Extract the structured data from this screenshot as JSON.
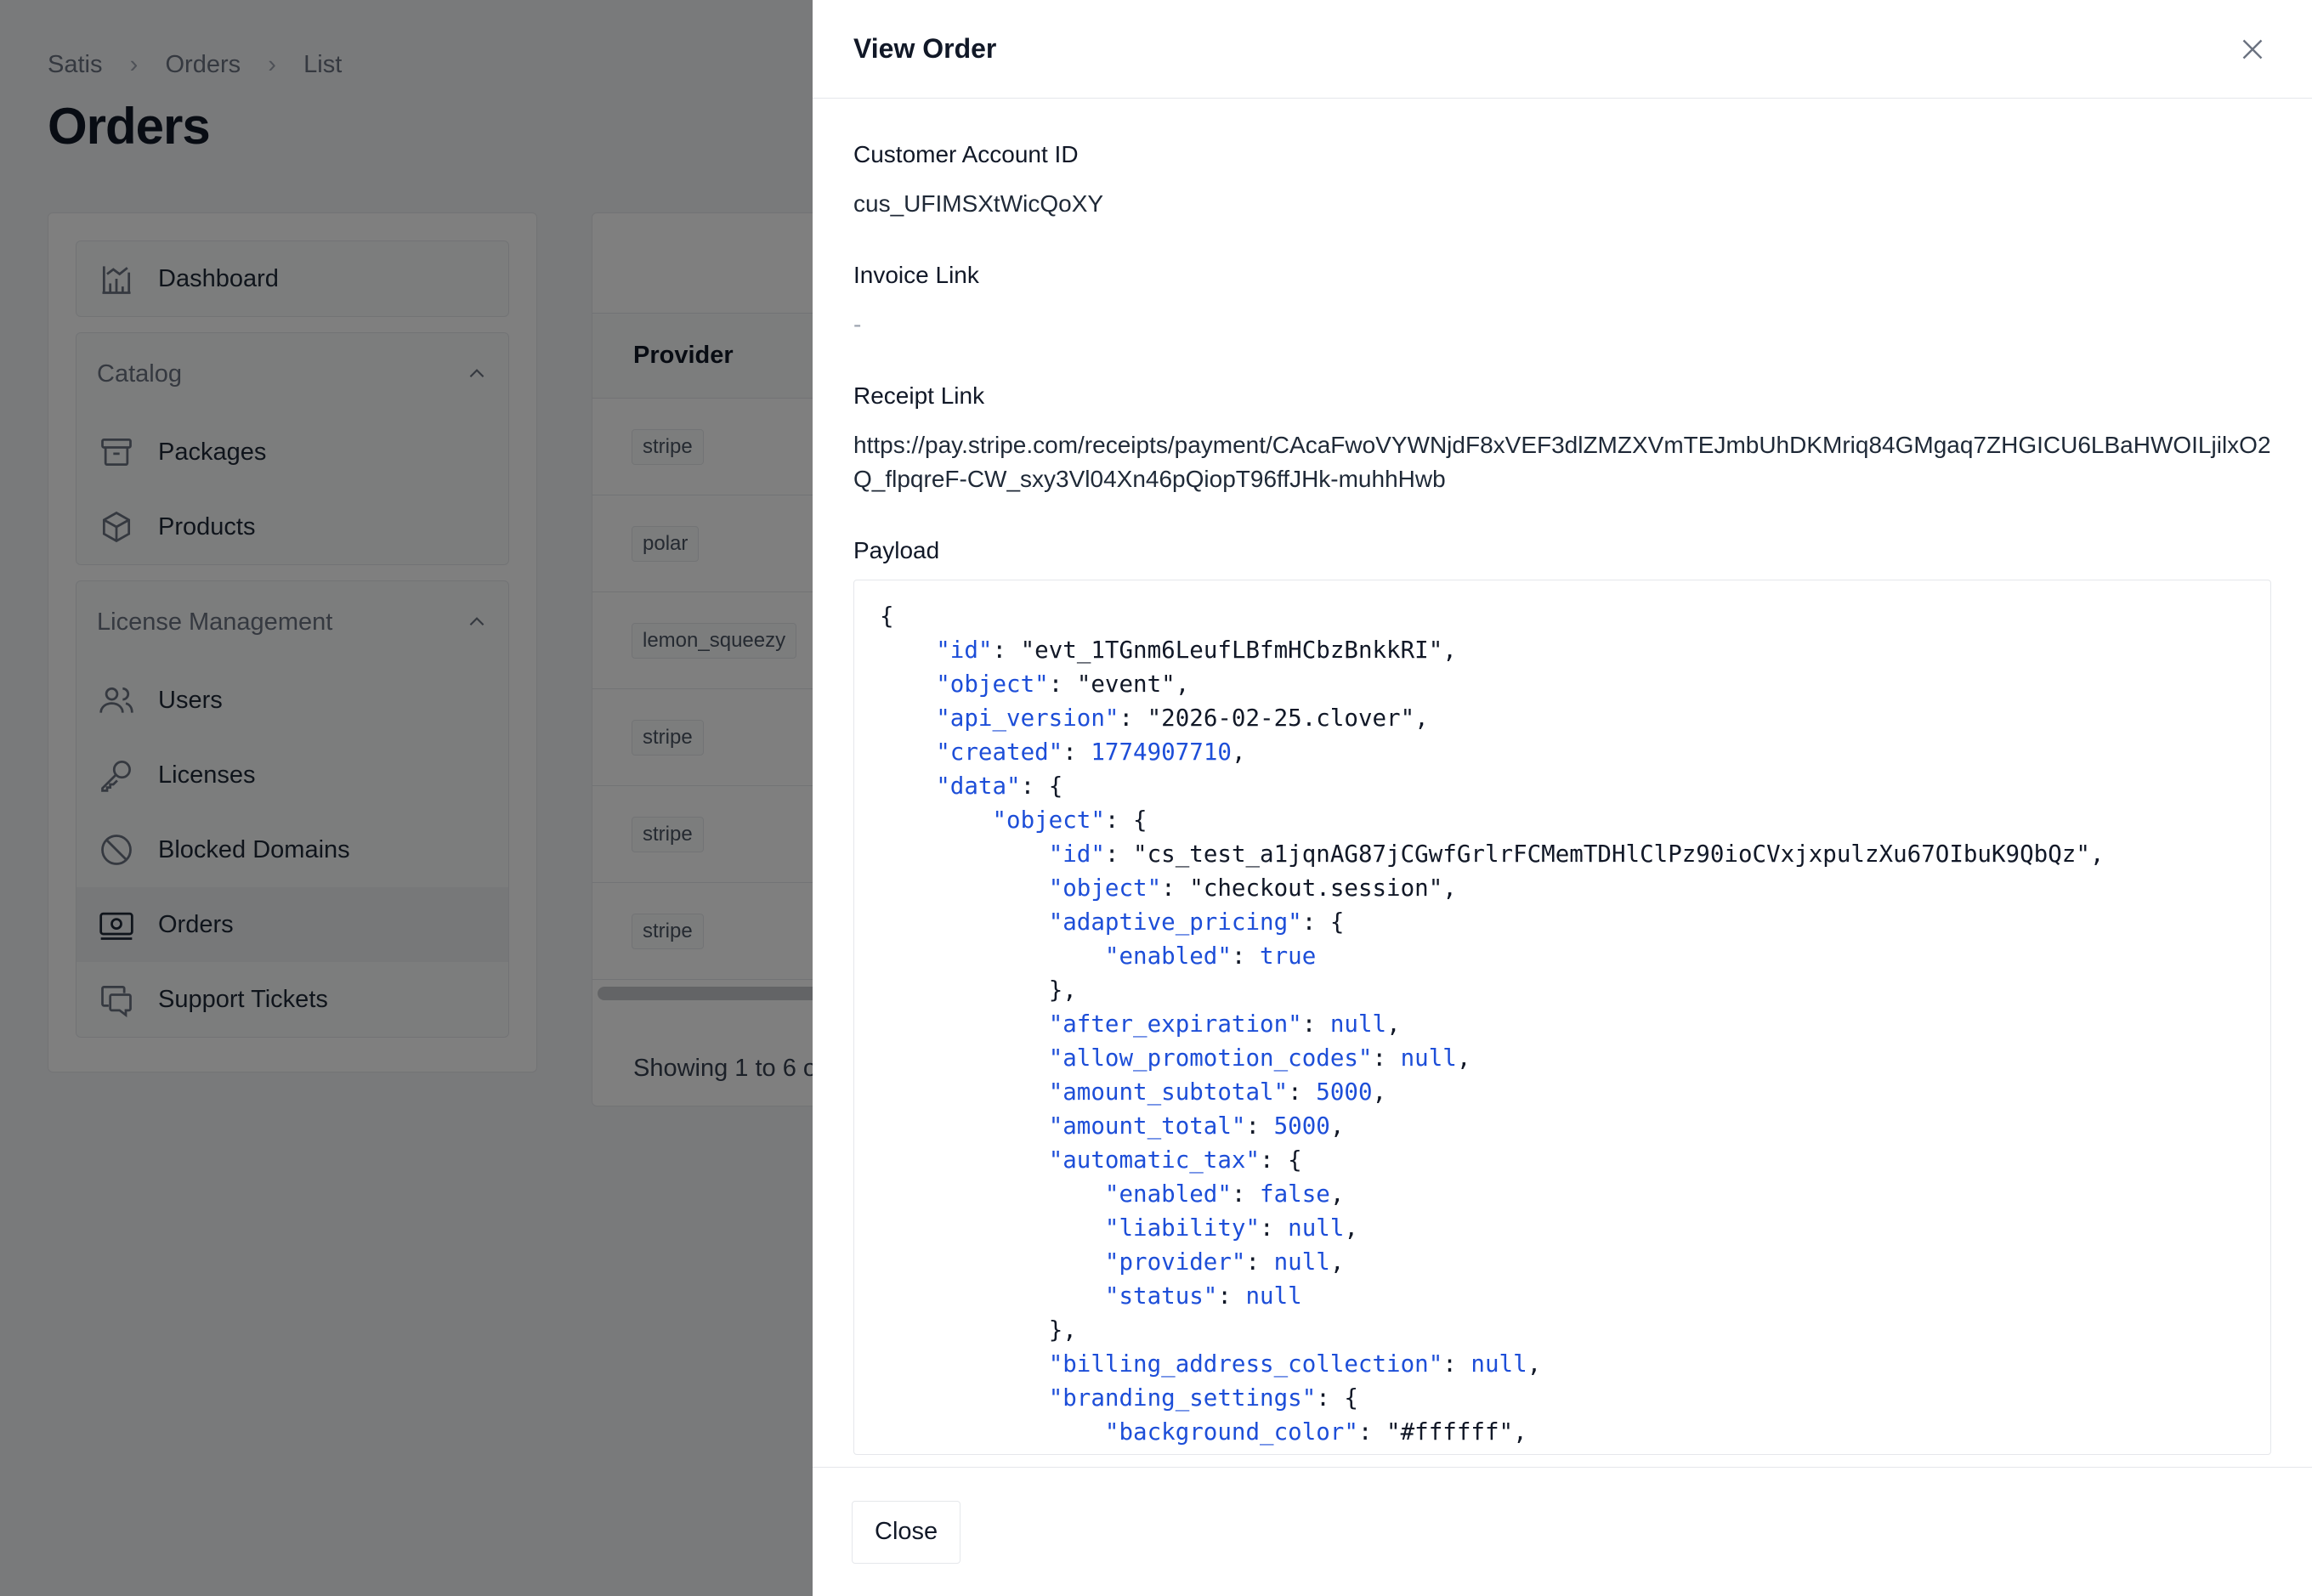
{
  "breadcrumb": [
    "Satis",
    "Orders",
    "List"
  ],
  "page_title": "Orders",
  "sidebar": {
    "dashboard": "Dashboard",
    "catalog": {
      "title": "Catalog",
      "items": [
        "Packages",
        "Products"
      ]
    },
    "license_management": {
      "title": "License Management",
      "items": [
        "Users",
        "Licenses",
        "Blocked Domains",
        "Orders",
        "Support Tickets"
      ]
    }
  },
  "table": {
    "column_provider": "Provider",
    "rows": [
      "stripe",
      "polar",
      "lemon_squeezy",
      "stripe",
      "stripe",
      "stripe"
    ],
    "footer": "Showing 1 to 6 o"
  },
  "modal": {
    "title": "View Order",
    "customer_label": "Customer Account ID",
    "customer_value": "cus_UFIMSXtWicQoXY",
    "invoice_label": "Invoice Link",
    "invoice_value": "-",
    "receipt_label": "Receipt Link",
    "receipt_value": "https://pay.stripe.com/receipts/payment/CAcaFwoVYWNjdF8xVEF3dlZMZXVmTEJmbUhDKMriq84GMgaq7ZHGICU6LBaHWOILjilxO2Q_flpqreF-CW_sxy3Vl04Xn46pQiopT96ffJHk-muhhHwb",
    "payload_label": "Payload",
    "close_button": "Close"
  },
  "payload_lines": [
    {
      "indent": 0,
      "text": "{"
    },
    {
      "indent": 1,
      "key": "id",
      "value": "\"evt_1TGnm6LeufLBfmHCbzBnkkRI\"",
      "type": "s",
      "tail": ","
    },
    {
      "indent": 1,
      "key": "object",
      "value": "\"event\"",
      "type": "s",
      "tail": ","
    },
    {
      "indent": 1,
      "key": "api_version",
      "value": "\"2026-02-25.clover\"",
      "type": "s",
      "tail": ","
    },
    {
      "indent": 1,
      "key": "created",
      "value": "1774907710",
      "type": "n",
      "tail": ","
    },
    {
      "indent": 1,
      "key": "data",
      "value": "{",
      "type": "p",
      "tail": ""
    },
    {
      "indent": 2,
      "key": "object",
      "value": "{",
      "type": "p",
      "tail": ""
    },
    {
      "indent": 3,
      "key": "id",
      "value": "\"cs_test_a1jqnAG87jCGwfGrlrFCMemTDHlClPz90ioCVxjxpulzXu67OIbuK9QbQz\"",
      "type": "s",
      "tail": ","
    },
    {
      "indent": 3,
      "key": "object",
      "value": "\"checkout.session\"",
      "type": "s",
      "tail": ","
    },
    {
      "indent": 3,
      "key": "adaptive_pricing",
      "value": "{",
      "type": "p",
      "tail": ""
    },
    {
      "indent": 4,
      "key": "enabled",
      "value": "true",
      "type": "n",
      "tail": ""
    },
    {
      "indent": 3,
      "text": "},"
    },
    {
      "indent": 3,
      "key": "after_expiration",
      "value": "null",
      "type": "n",
      "tail": ","
    },
    {
      "indent": 3,
      "key": "allow_promotion_codes",
      "value": "null",
      "type": "n",
      "tail": ","
    },
    {
      "indent": 3,
      "key": "amount_subtotal",
      "value": "5000",
      "type": "n",
      "tail": ","
    },
    {
      "indent": 3,
      "key": "amount_total",
      "value": "5000",
      "type": "n",
      "tail": ","
    },
    {
      "indent": 3,
      "key": "automatic_tax",
      "value": "{",
      "type": "p",
      "tail": ""
    },
    {
      "indent": 4,
      "key": "enabled",
      "value": "false",
      "type": "n",
      "tail": ","
    },
    {
      "indent": 4,
      "key": "liability",
      "value": "null",
      "type": "n",
      "tail": ","
    },
    {
      "indent": 4,
      "key": "provider",
      "value": "null",
      "type": "n",
      "tail": ","
    },
    {
      "indent": 4,
      "key": "status",
      "value": "null",
      "type": "n",
      "tail": ""
    },
    {
      "indent": 3,
      "text": "},"
    },
    {
      "indent": 3,
      "key": "billing_address_collection",
      "value": "null",
      "type": "n",
      "tail": ","
    },
    {
      "indent": 3,
      "key": "branding_settings",
      "value": "{",
      "type": "p",
      "tail": ""
    },
    {
      "indent": 4,
      "key": "background_color",
      "value": "\"#ffffff\"",
      "type": "s",
      "tail": ","
    }
  ]
}
